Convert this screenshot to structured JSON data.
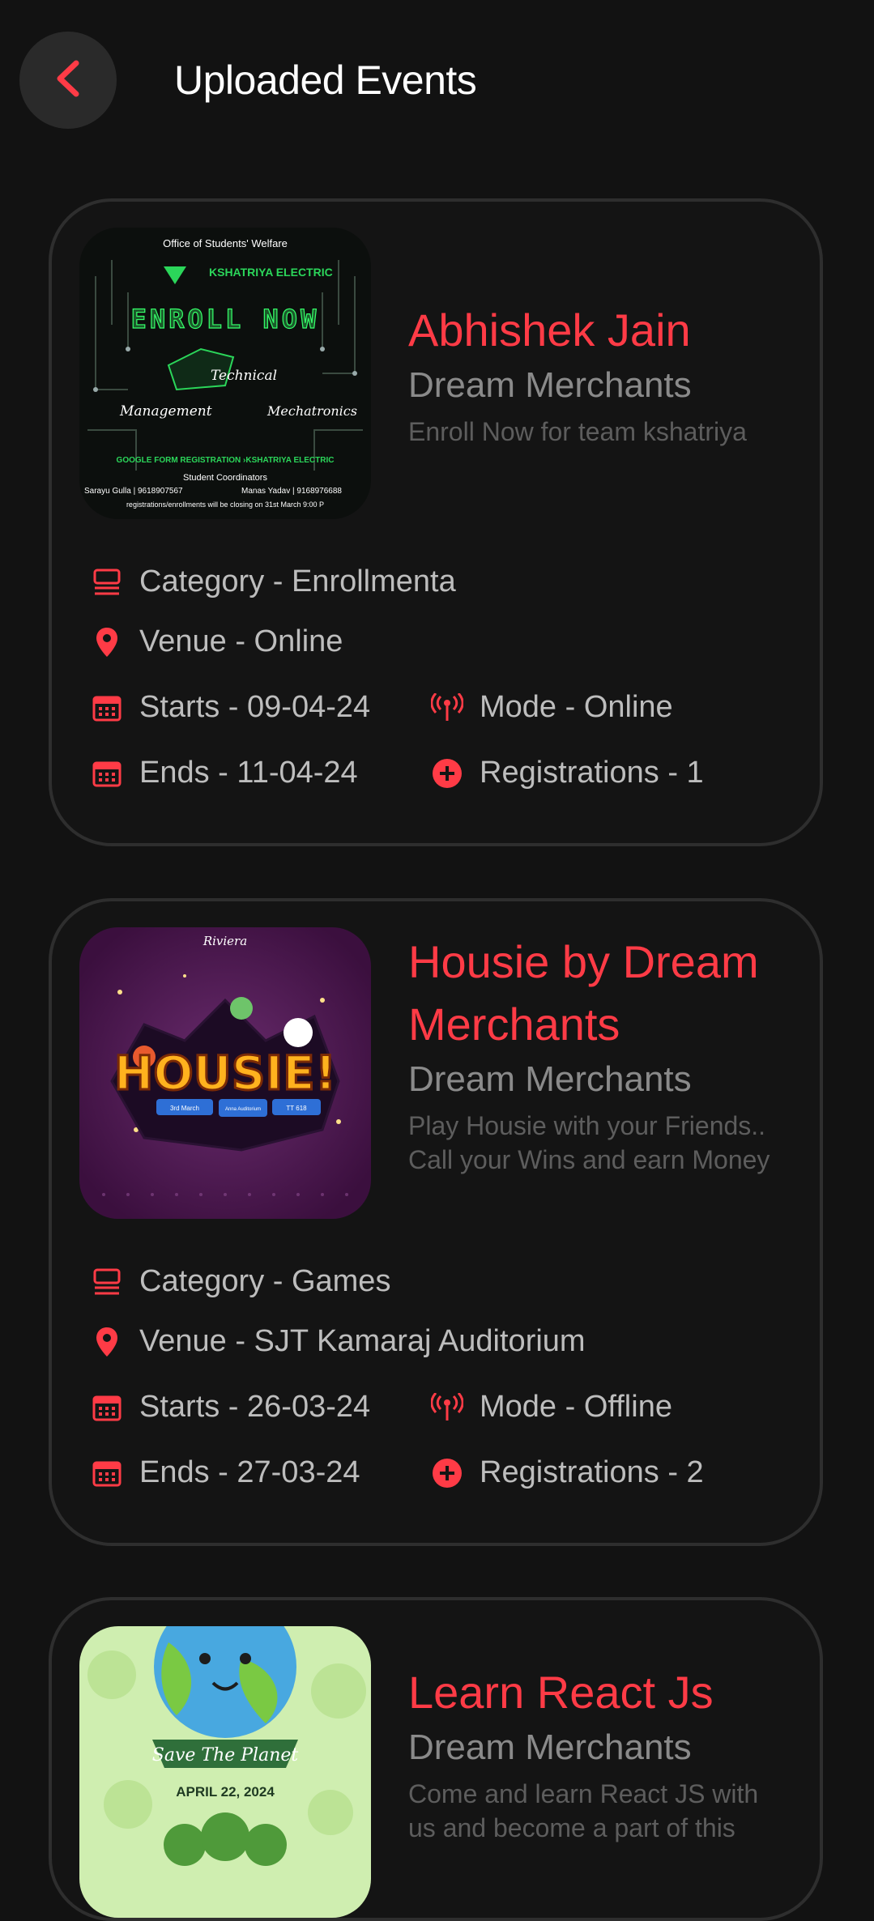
{
  "header": {
    "title": "Uploaded Events"
  },
  "colors": {
    "accent": "#ff3b46",
    "background": "#121212",
    "card_border": "#2e2e2e"
  },
  "events": [
    {
      "title": "Abhishek Jain",
      "organizer": "Dream Merchants",
      "description": "Enroll Now for team kshatriya",
      "category": "Category - Enrollmenta",
      "venue": "Venue - Online",
      "starts": "Starts - 09-04-24",
      "ends": "Ends - 11-04-24",
      "mode": "Mode - Online",
      "registrations": "Registrations - 1",
      "poster": {
        "top": "Office of Students' Welfare",
        "brand": "KSHATRIYA ELECTRIC",
        "headline": "ENROLL NOW",
        "tags": [
          "Technical",
          "Management",
          "Mechatronics"
        ],
        "footer": "GOOGLE FORM REGISTRATION ›KSHATRIYA ELECTRIC",
        "coord_title": "Student Coordinators",
        "coord_left": "Sarayu Gulla | 9618907567",
        "coord_right": "Manas Yadav | 9168976688",
        "note": "registrations/enrollments will be closing on 31st March 9:00 P"
      }
    },
    {
      "title": "Housie by Dream Merchants",
      "organizer": "Dream Merchants",
      "description": "Play Housie with your Friends.. Call your Wins and earn Money",
      "category": "Category - Games",
      "venue": "Venue - SJT Kamaraj Auditorium",
      "starts": "Starts - 26-03-24",
      "ends": "Ends - 27-03-24",
      "mode": "Mode - Offline",
      "registrations": "Registrations - 2",
      "poster": {
        "brand": "Riviera",
        "headline": "HOUSIE!",
        "date": "3rd March",
        "venue": "Anna Auditorium",
        "room": "TT 618"
      }
    },
    {
      "title": "Learn React Js",
      "organizer": "Dream Merchants",
      "description": "Come and learn React JS with us and become a part of this",
      "poster": {
        "banner": "Save The Planet",
        "date": "APRIL 22, 2024"
      }
    }
  ]
}
